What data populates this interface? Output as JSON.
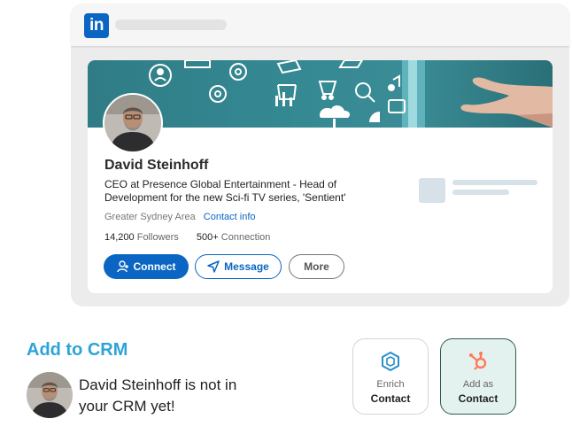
{
  "browser": {
    "logo_text": "in",
    "logo_icon": "linkedin-icon"
  },
  "profile": {
    "name": "David Steinhoff",
    "headline": "CEO at Presence Global Entertainment - Head of Development for the new Sci-fi TV series, 'Sentient'",
    "location": "Greater Sydney Area",
    "contact_link": "Contact info",
    "followers_count": "14,200",
    "followers_label": "Followers",
    "connections_count": "500+",
    "connections_label": "Connection",
    "buttons": {
      "connect": "Connect",
      "message": "Message",
      "more": "More"
    }
  },
  "crm": {
    "title": "Add to CRM",
    "message": "David Steinhoff is not in your CRM yet!",
    "enrich": {
      "small": "Enrich",
      "bold": "Contact",
      "icon": "enrich-icon"
    },
    "hubspot": {
      "small": "Add as",
      "bold": "Contact",
      "icon": "hubspot-icon"
    }
  },
  "colors": {
    "linkedin_blue": "#0a66c2",
    "crm_title": "#2da3d8",
    "hubspot_orange": "#ff7a59",
    "enrich_blue": "#2a8fc7"
  }
}
